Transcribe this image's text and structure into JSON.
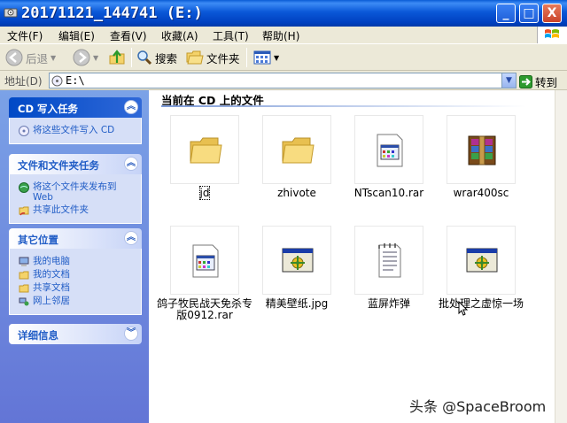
{
  "window": {
    "title": "20171121_144741 (E:)",
    "controls": {
      "minimize": "_",
      "maximize": "□",
      "close": "X"
    }
  },
  "menu": [
    "文件(F)",
    "编辑(E)",
    "查看(V)",
    "收藏(A)",
    "工具(T)",
    "帮助(H)"
  ],
  "toolbar": {
    "back": "后退",
    "search": "搜索",
    "folders": "文件夹"
  },
  "address": {
    "label": "地址(D)",
    "value": "E:\\",
    "go": "转到"
  },
  "sidebar": {
    "cd_tasks": {
      "title": "CD 写入任务",
      "items": [
        "将这些文件写入 CD"
      ]
    },
    "file_tasks": {
      "title": "文件和文件夹任务",
      "items": [
        "将这个文件夹发布到 Web",
        "共享此文件夹"
      ]
    },
    "other_places": {
      "title": "其它位置",
      "items": [
        "我的电脑",
        "我的文档",
        "共享文档",
        "网上邻居"
      ]
    },
    "details": {
      "title": "详细信息"
    }
  },
  "content": {
    "heading": "当前在 CD 上的文件",
    "files": [
      {
        "name": "jd",
        "icon": "folder-icon"
      },
      {
        "name": "zhivote",
        "icon": "folder-icon"
      },
      {
        "name": "NTscan10.rar",
        "icon": "rar-file-icon"
      },
      {
        "name": "wrar400sc",
        "icon": "winrar-installer-icon"
      },
      {
        "name": "鸽子牧民战天免杀专版0912.rar",
        "icon": "rar-file-icon"
      },
      {
        "name": "精美壁纸.jpg",
        "icon": "program-window-icon"
      },
      {
        "name": "蓝屏炸弹",
        "icon": "text-file-icon"
      },
      {
        "name": "批处理之虚惊一场",
        "icon": "program-window-icon"
      }
    ]
  },
  "watermark": "头条 @SpaceBroom",
  "colors": {
    "titlebar": "#0a58d8",
    "sidebar": "#6f8ddf",
    "link": "#215dc6"
  }
}
